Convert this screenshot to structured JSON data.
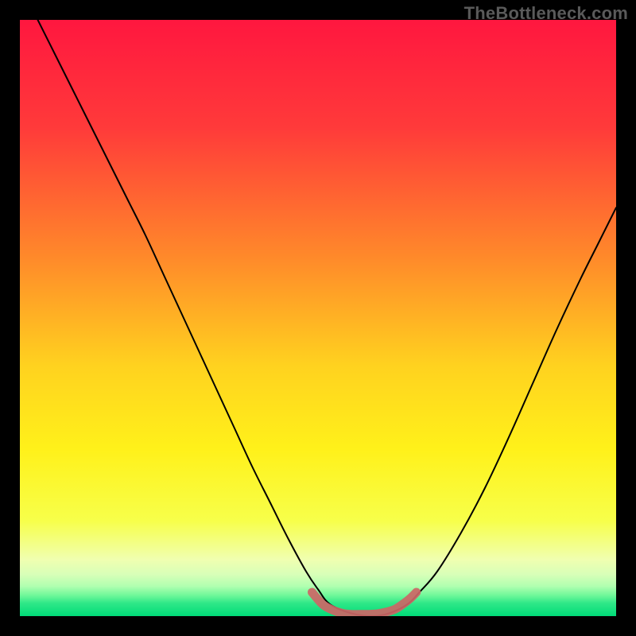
{
  "watermark": "TheBottleneck.com",
  "chart_data": {
    "type": "line",
    "title": "",
    "xlabel": "",
    "ylabel": "",
    "xlim": [
      0,
      1
    ],
    "ylim": [
      0,
      1
    ],
    "background_gradient": [
      {
        "stop": 0.0,
        "color": "#ff173f"
      },
      {
        "stop": 0.18,
        "color": "#ff3a3a"
      },
      {
        "stop": 0.4,
        "color": "#ff8a2a"
      },
      {
        "stop": 0.58,
        "color": "#ffd21f"
      },
      {
        "stop": 0.72,
        "color": "#fff11a"
      },
      {
        "stop": 0.84,
        "color": "#f7ff4a"
      },
      {
        "stop": 0.905,
        "color": "#f0ffb0"
      },
      {
        "stop": 0.93,
        "color": "#d8ffb8"
      },
      {
        "stop": 0.95,
        "color": "#b0ffb0"
      },
      {
        "stop": 0.965,
        "color": "#70f89a"
      },
      {
        "stop": 0.978,
        "color": "#30e888"
      },
      {
        "stop": 1.0,
        "color": "#00db78"
      }
    ],
    "series": [
      {
        "name": "bottleneck-curve",
        "stroke": "#000000",
        "stroke_width": 2,
        "x": [
          0.03,
          0.06,
          0.09,
          0.12,
          0.15,
          0.18,
          0.21,
          0.24,
          0.27,
          0.3,
          0.33,
          0.36,
          0.39,
          0.42,
          0.45,
          0.48,
          0.5,
          0.52,
          0.555,
          0.59,
          0.62,
          0.65,
          0.67,
          0.7,
          0.74,
          0.78,
          0.82,
          0.86,
          0.9,
          0.94,
          0.97,
          1.0
        ],
        "y": [
          1.0,
          0.94,
          0.88,
          0.82,
          0.76,
          0.7,
          0.64,
          0.575,
          0.51,
          0.445,
          0.38,
          0.315,
          0.25,
          0.19,
          0.13,
          0.075,
          0.045,
          0.02,
          0.005,
          0.0,
          0.005,
          0.02,
          0.04,
          0.075,
          0.14,
          0.215,
          0.3,
          0.39,
          0.48,
          0.565,
          0.625,
          0.685
        ]
      },
      {
        "name": "zero-band",
        "stroke": "#cc6666",
        "stroke_width": 11,
        "linecap": "round",
        "x": [
          0.49,
          0.5,
          0.51,
          0.525,
          0.54,
          0.555,
          0.57,
          0.585,
          0.6,
          0.615,
          0.63,
          0.645,
          0.655,
          0.665
        ],
        "y": [
          0.04,
          0.028,
          0.018,
          0.01,
          0.005,
          0.003,
          0.003,
          0.003,
          0.004,
          0.007,
          0.012,
          0.022,
          0.03,
          0.04
        ]
      }
    ]
  }
}
